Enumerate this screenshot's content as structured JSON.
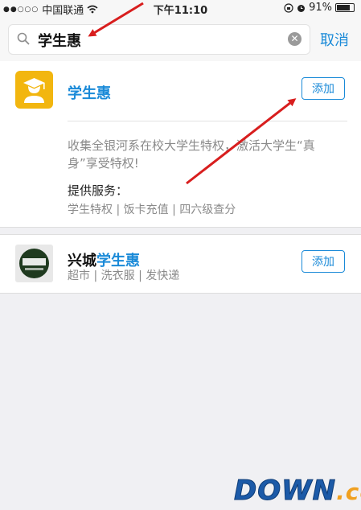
{
  "status_bar": {
    "signal": "●●○○○",
    "carrier": "中国联通",
    "time": "下午11:10",
    "battery": "91%",
    "battery_level": 0.91
  },
  "search": {
    "value": "学生惠",
    "cancel_label": "取消"
  },
  "results": [
    {
      "name": "学生惠",
      "add_label": "添加",
      "description": "收集全银河系在校大学生特权，激活大学生“真身”享受特权!",
      "services_label": "提供服务：",
      "services": "学生特权 | 饭卡充值 | 四六级查分"
    },
    {
      "name_prefix": "兴城",
      "name_highlight": "学生惠",
      "add_label": "添加",
      "tags": "超市 | 洗衣服 | 发快递"
    }
  ],
  "watermark": {
    "main": "DOWN",
    "suffix": ".cc"
  },
  "colors": {
    "accent": "#1a8ad8",
    "logo_yellow": "#f2b60f",
    "arrow_red": "#d81e1e"
  }
}
